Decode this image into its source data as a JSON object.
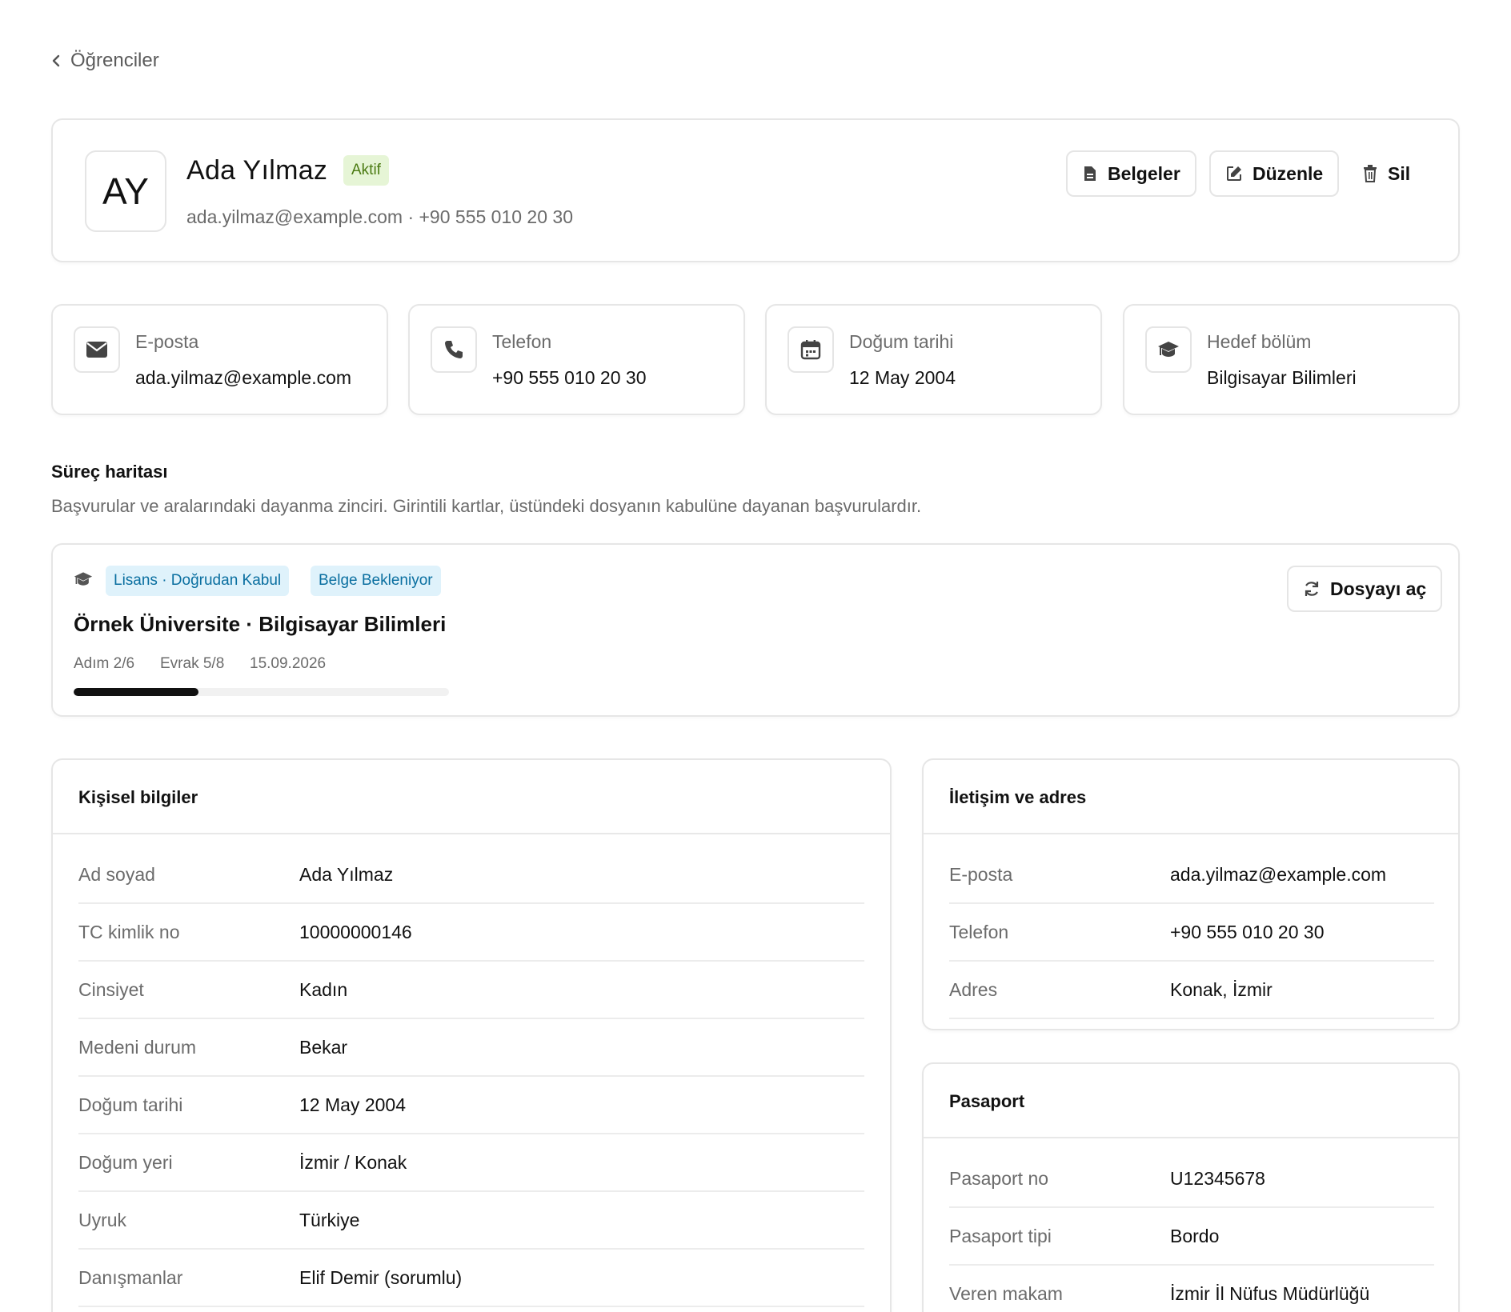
{
  "back": {
    "label": "Öğrenciler"
  },
  "profile": {
    "initials": "AY",
    "name": "Ada Yılmaz",
    "status": "Aktif",
    "subline": "ada.yilmaz@example.com · +90 555 010 20 30"
  },
  "actions": {
    "documents": "Belgeler",
    "edit": "Düzenle",
    "delete": "Sil"
  },
  "info_cards": [
    {
      "label": "E-posta",
      "value": "ada.yilmaz@example.com",
      "icon": "envelope-icon"
    },
    {
      "label": "Telefon",
      "value": "+90 555 010 20 30",
      "icon": "phone-icon"
    },
    {
      "label": "Doğum tarihi",
      "value": "12 May 2004",
      "icon": "calendar-icon"
    },
    {
      "label": "Hedef bölüm",
      "value": "Bilgisayar Bilimleri",
      "icon": "graduation-cap-icon"
    }
  ],
  "process": {
    "title": "Süreç haritası",
    "description": "Başvurular ve aralarındaki dayanma zinciri. Girintili kartlar, üstündeki dosyanın kabulüne dayanan başvurulardır.",
    "application": {
      "tags": [
        "Lisans · Doğrudan Kabul",
        "Belge Bekleniyor"
      ],
      "title": "Örnek Üniversite · Bilgisayar Bilimleri",
      "step": "Adım 2/6",
      "docs": "Evrak 5/8",
      "date": "15.09.2026",
      "progress": 0.333,
      "open_label": "Dosyayı aç"
    }
  },
  "personal": {
    "title": "Kişisel bilgiler",
    "rows": [
      {
        "k": "Ad soyad",
        "v": "Ada Yılmaz"
      },
      {
        "k": "TC kimlik no",
        "v": "10000000146"
      },
      {
        "k": "Cinsiyet",
        "v": "Kadın"
      },
      {
        "k": "Medeni durum",
        "v": "Bekar"
      },
      {
        "k": "Doğum tarihi",
        "v": "12 May 2004"
      },
      {
        "k": "Doğum yeri",
        "v": "İzmir / Konak"
      },
      {
        "k": "Uyruk",
        "v": "Türkiye"
      },
      {
        "k": "Danışmanlar",
        "v": "Elif Demir (sorumlu)"
      }
    ]
  },
  "contact": {
    "title": "İletişim ve adres",
    "rows": [
      {
        "k": "E-posta",
        "v": "ada.yilmaz@example.com"
      },
      {
        "k": "Telefon",
        "v": "+90 555 010 20 30"
      },
      {
        "k": "Adres",
        "v": "Konak, İzmir"
      }
    ]
  },
  "passport": {
    "title": "Pasaport",
    "rows": [
      {
        "k": "Pasaport no",
        "v": "U12345678"
      },
      {
        "k": "Pasaport tipi",
        "v": "Bordo"
      },
      {
        "k": "Veren makam",
        "v": "İzmir İl Nüfus Müdürlüğü"
      }
    ]
  },
  "colors": {
    "accent": "#111111",
    "status_bg": "#e6f5d6",
    "status_fg": "#4b7b12",
    "tag_bg": "#dff2fb",
    "tag_fg": "#0a6fa0"
  }
}
